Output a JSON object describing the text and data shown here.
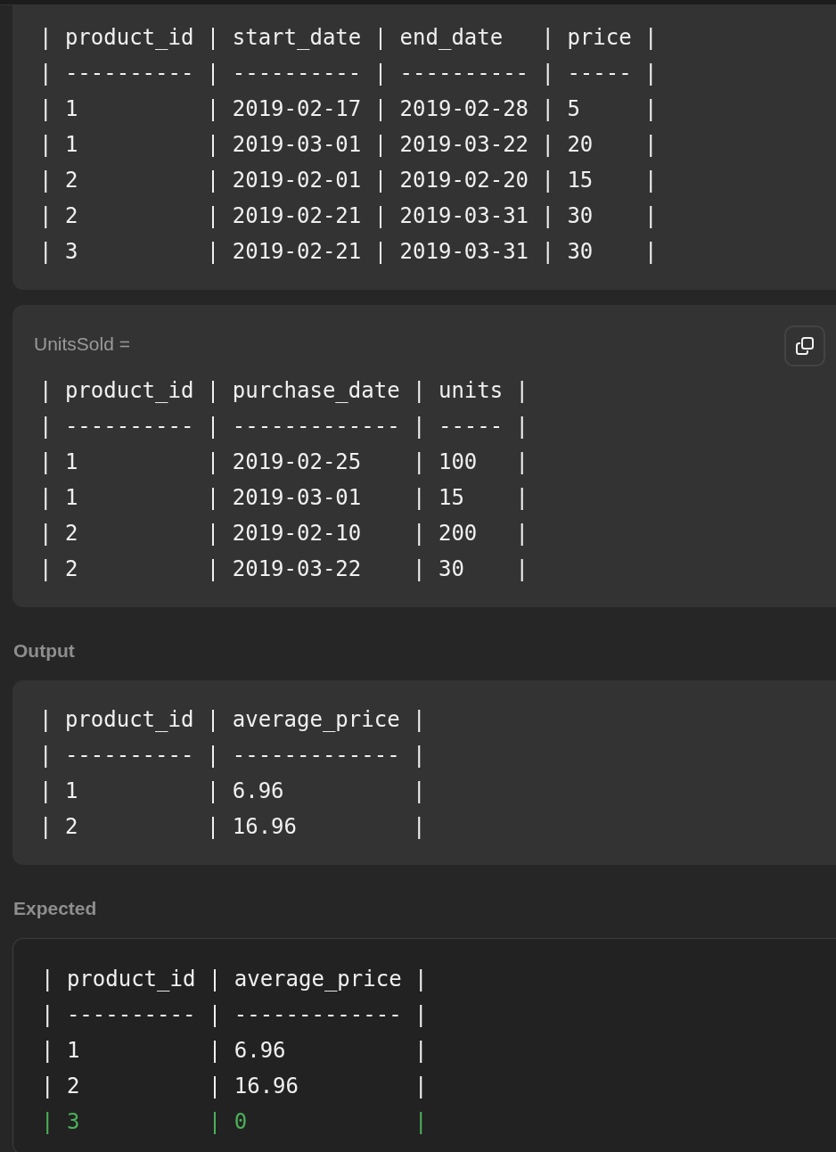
{
  "sections": [
    {
      "block": {
        "kind": "filled",
        "lines": [
          {
            "text": "| product_id | start_date | end_date   | price |",
            "added": false
          },
          {
            "text": "| ---------- | ---------- | ---------- | ----- |",
            "added": false
          },
          {
            "text": "| 1          | 2019-02-17 | 2019-02-28 | 5     |",
            "added": false
          },
          {
            "text": "| 1          | 2019-03-01 | 2019-03-22 | 20    |",
            "added": false
          },
          {
            "text": "| 2          | 2019-02-01 | 2019-02-20 | 15    |",
            "added": false
          },
          {
            "text": "| 2          | 2019-02-21 | 2019-03-31 | 30    |",
            "added": false
          },
          {
            "text": "| 3          | 2019-02-21 | 2019-03-31 | 30    |",
            "added": false
          }
        ]
      }
    },
    {
      "block": {
        "kind": "filled",
        "label": "UnitsSold =",
        "copy_button": true,
        "lines": [
          {
            "text": "| product_id | purchase_date | units |",
            "added": false
          },
          {
            "text": "| ---------- | ------------- | ----- |",
            "added": false
          },
          {
            "text": "| 1          | 2019-02-25    | 100   |",
            "added": false
          },
          {
            "text": "| 1          | 2019-03-01    | 15    |",
            "added": false
          },
          {
            "text": "| 2          | 2019-02-10    | 200   |",
            "added": false
          },
          {
            "text": "| 2          | 2019-03-22    | 30    |",
            "added": false
          }
        ]
      }
    },
    {
      "heading": "Output",
      "block": {
        "kind": "filled",
        "lines": [
          {
            "text": "| product_id | average_price |",
            "added": false
          },
          {
            "text": "| ---------- | ------------- |",
            "added": false
          },
          {
            "text": "| 1          | 6.96          |",
            "added": false
          },
          {
            "text": "| 2          | 16.96         |",
            "added": false
          }
        ]
      }
    },
    {
      "heading": "Expected",
      "block": {
        "kind": "outlined",
        "lines": [
          {
            "text": "| product_id | average_price |",
            "added": false
          },
          {
            "text": "| ---------- | ------------- |",
            "added": false
          },
          {
            "text": "| 1          | 6.96          |",
            "added": false
          },
          {
            "text": "| 2          | 16.96         |",
            "added": false
          },
          {
            "text": "| 3          | 0             |",
            "added": true
          }
        ]
      }
    }
  ]
}
